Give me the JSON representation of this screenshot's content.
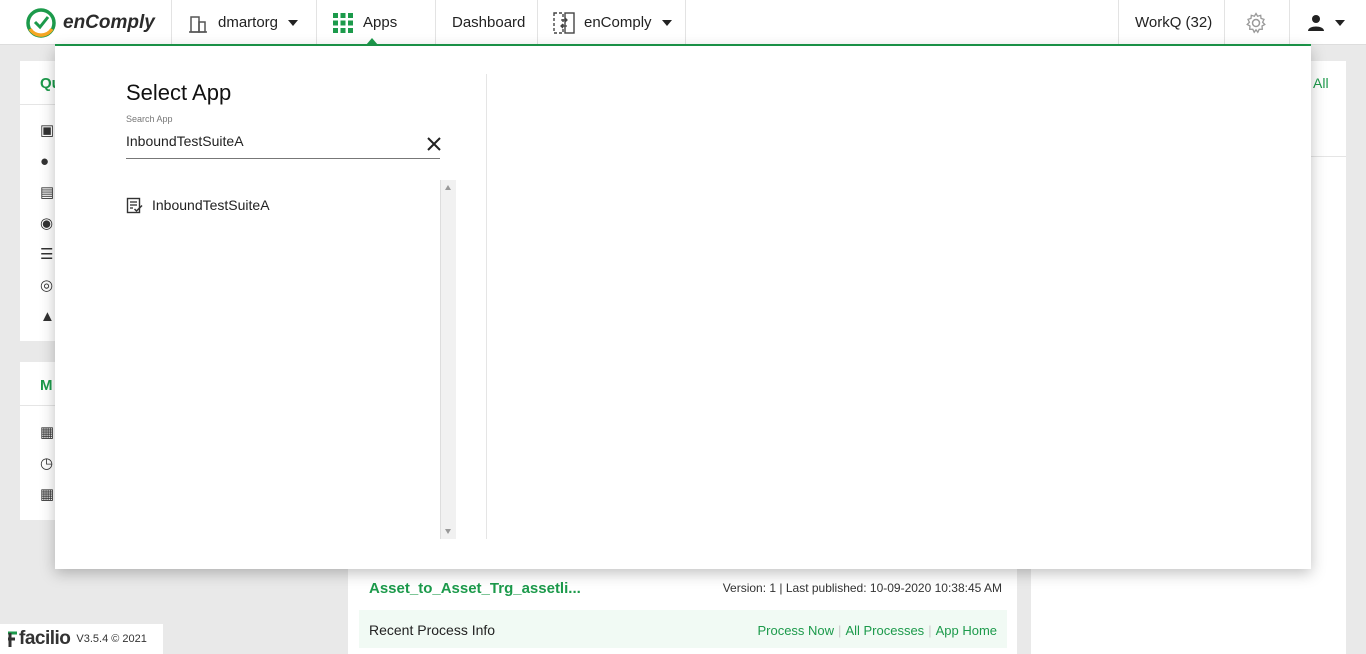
{
  "header": {
    "logo_text": "enComply",
    "org": "dmartorg",
    "apps_label": "Apps",
    "dashboard_label": "Dashboard",
    "app_switcher_label": "enComply",
    "workq_label": "WorkQ (32)"
  },
  "background": {
    "card1_title_partial": "Qu",
    "view_all_partial": "All",
    "card2_title_partial": "M",
    "app_card": {
      "title": "Asset_to_Asset_Trg_assetli...",
      "version_info": "Version: 1 | Last published: 10-09-2020 10:38:45 AM",
      "recent_label": "Recent Process Info",
      "links": [
        "Process Now",
        "All Processes",
        "App Home"
      ]
    }
  },
  "modal": {
    "title": "Select App",
    "search_label": "Search App",
    "search_value": "InboundTestSuiteA",
    "results": [
      {
        "label": "InboundTestSuiteA"
      }
    ]
  },
  "footer": {
    "brand": "facilio",
    "version": "V3.5.4 © 2021"
  },
  "colors": {
    "accent": "#1c9a4b",
    "logo_orange": "#f5a623"
  }
}
